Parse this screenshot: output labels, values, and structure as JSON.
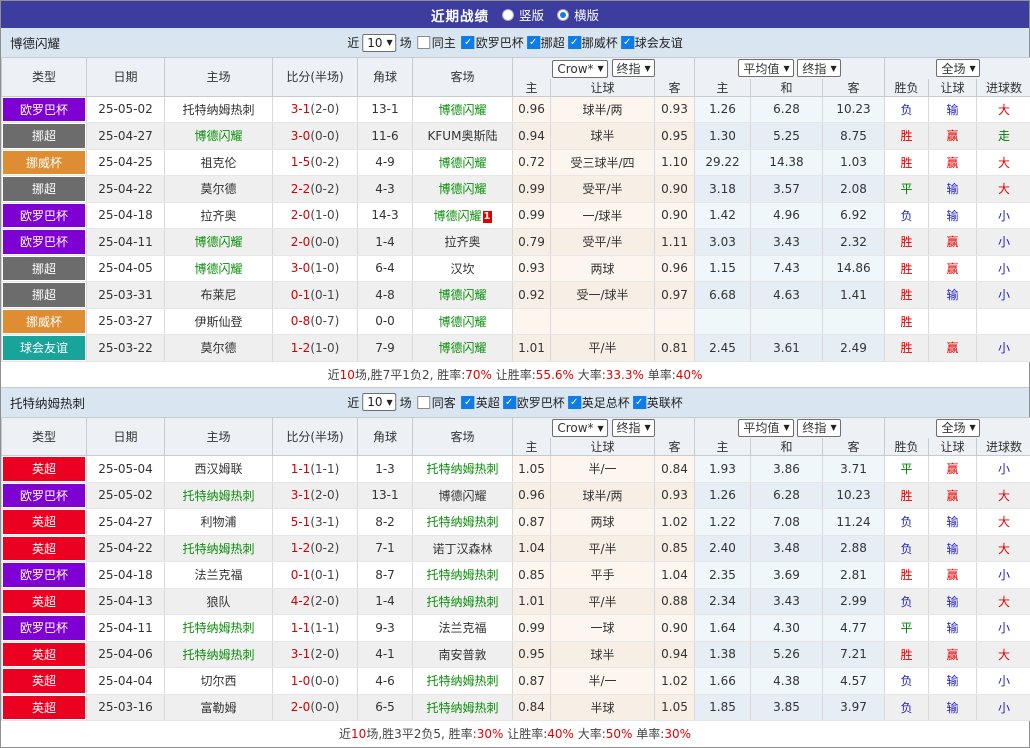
{
  "topbar": {
    "title": "近期战绩",
    "options": [
      {
        "label": "竖版",
        "selected": false
      },
      {
        "label": "横版",
        "selected": true
      }
    ]
  },
  "icons": {
    "check": "✓",
    "arrow": "▼"
  },
  "colors": {
    "topbar_bg": "#3d3da0",
    "section_bar_bg": "#d9e6f2",
    "focus_team": "#0a8f0a",
    "score": "#d40000",
    "stat_highlight": "#e60000",
    "checkbox_checked": "#0d7ce8",
    "radio_dot": "#0d7ce8"
  },
  "league_colors": {
    "欧罗巴杯": "#7f00d2",
    "挪超": "#6c6c6c",
    "挪威杯": "#de8d33",
    "球会友谊": "#18a39b",
    "英超": "#ec0022"
  },
  "result_colors": {
    "胜": "#e60000",
    "平": "#008000",
    "负": "#2222cc",
    "赢": "#e60000",
    "输": "#2222cc",
    "走": "#008000",
    "大": "#e60000",
    "小": "#2222cc"
  },
  "table": {
    "col_type": "类型",
    "col_date": "日期",
    "col_home": "主场",
    "col_score": "比分(半场)",
    "col_corner": "角球",
    "col_away": "客场",
    "sel_crow": "Crow*",
    "sel_final1": "终指",
    "sel_avg": "平均值",
    "sel_final2": "终指",
    "sel_fulltime": "全场",
    "col_h": "主",
    "col_hcap": "让球",
    "col_a": "客",
    "col_ah": "主",
    "col_ad": "和",
    "col_aa": "客",
    "col_result": "胜负",
    "col_hcap_result": "让球",
    "col_goals": "进球数"
  },
  "sections": [
    {
      "team": "博德闪耀",
      "filter": {
        "label_before": "近",
        "count": "10",
        "label_after": "场",
        "same_label": "同主",
        "same_checked": false,
        "leagues": [
          {
            "label": "欧罗巴杯",
            "checked": true
          },
          {
            "label": "挪超",
            "checked": true
          },
          {
            "label": "挪威杯",
            "checked": true
          },
          {
            "label": "球会友谊",
            "checked": true
          }
        ]
      },
      "rows": [
        {
          "league": "欧罗巴杯",
          "date": "25-05-02",
          "home": "托特纳姆热刺",
          "home_focus": false,
          "home_card": "",
          "score": "3-1",
          "half": "(2-0)",
          "corner": "13-1",
          "away": "博德闪耀",
          "away_focus": true,
          "away_card": "",
          "o1": "0.96",
          "handicap": "球半/两",
          "o2": "0.93",
          "avg_h": "1.26",
          "avg_d": "6.28",
          "avg_a": "10.23",
          "result": "负",
          "hcap_res": "输",
          "goal_res": "大"
        },
        {
          "league": "挪超",
          "date": "25-04-27",
          "home": "博德闪耀",
          "home_focus": true,
          "home_card": "",
          "score": "3-0",
          "half": "(0-0)",
          "corner": "11-6",
          "away": "KFUM奥斯陆",
          "away_focus": false,
          "away_card": "",
          "o1": "0.94",
          "handicap": "球半",
          "o2": "0.95",
          "avg_h": "1.30",
          "avg_d": "5.25",
          "avg_a": "8.75",
          "result": "胜",
          "hcap_res": "赢",
          "goal_res": "走"
        },
        {
          "league": "挪威杯",
          "date": "25-04-25",
          "home": "祖克伦",
          "home_focus": false,
          "home_card": "",
          "score": "1-5",
          "half": "(0-2)",
          "corner": "4-9",
          "away": "博德闪耀",
          "away_focus": true,
          "away_card": "",
          "o1": "0.72",
          "handicap": "受三球半/四",
          "o2": "1.10",
          "avg_h": "29.22",
          "avg_d": "14.38",
          "avg_a": "1.03",
          "result": "胜",
          "hcap_res": "赢",
          "goal_res": "大"
        },
        {
          "league": "挪超",
          "date": "25-04-22",
          "home": "莫尔德",
          "home_focus": false,
          "home_card": "",
          "score": "2-2",
          "half": "(0-2)",
          "corner": "4-3",
          "away": "博德闪耀",
          "away_focus": true,
          "away_card": "",
          "o1": "0.99",
          "handicap": "受平/半",
          "o2": "0.90",
          "avg_h": "3.18",
          "avg_d": "3.57",
          "avg_a": "2.08",
          "result": "平",
          "hcap_res": "输",
          "goal_res": "大"
        },
        {
          "league": "欧罗巴杯",
          "date": "25-04-18",
          "home": "拉齐奥",
          "home_focus": false,
          "home_card": "",
          "score": "2-0",
          "half": "(1-0)",
          "corner": "14-3",
          "away": "博德闪耀",
          "away_focus": true,
          "away_card": "1",
          "o1": "0.99",
          "handicap": "一/球半",
          "o2": "0.90",
          "avg_h": "1.42",
          "avg_d": "4.96",
          "avg_a": "6.92",
          "result": "负",
          "hcap_res": "输",
          "goal_res": "小"
        },
        {
          "league": "欧罗巴杯",
          "date": "25-04-11",
          "home": "博德闪耀",
          "home_focus": true,
          "home_card": "",
          "score": "2-0",
          "half": "(0-0)",
          "corner": "1-4",
          "away": "拉齐奥",
          "away_focus": false,
          "away_card": "",
          "o1": "0.79",
          "handicap": "受平/半",
          "o2": "1.11",
          "avg_h": "3.03",
          "avg_d": "3.43",
          "avg_a": "2.32",
          "result": "胜",
          "hcap_res": "赢",
          "goal_res": "小"
        },
        {
          "league": "挪超",
          "date": "25-04-05",
          "home": "博德闪耀",
          "home_focus": true,
          "home_card": "",
          "score": "3-0",
          "half": "(1-0)",
          "corner": "6-4",
          "away": "汉坎",
          "away_focus": false,
          "away_card": "",
          "o1": "0.93",
          "handicap": "两球",
          "o2": "0.96",
          "avg_h": "1.15",
          "avg_d": "7.43",
          "avg_a": "14.86",
          "result": "胜",
          "hcap_res": "赢",
          "goal_res": "小"
        },
        {
          "league": "挪超",
          "date": "25-03-31",
          "home": "布莱尼",
          "home_focus": false,
          "home_card": "",
          "score": "0-1",
          "half": "(0-1)",
          "corner": "4-8",
          "away": "博德闪耀",
          "away_focus": true,
          "away_card": "",
          "o1": "0.92",
          "handicap": "受一/球半",
          "o2": "0.97",
          "avg_h": "6.68",
          "avg_d": "4.63",
          "avg_a": "1.41",
          "result": "胜",
          "hcap_res": "输",
          "goal_res": "小"
        },
        {
          "league": "挪威杯",
          "date": "25-03-27",
          "home": "伊斯仙登",
          "home_focus": false,
          "home_card": "",
          "score": "0-8",
          "half": "(0-7)",
          "corner": "0-0",
          "away": "博德闪耀",
          "away_focus": true,
          "away_card": "",
          "o1": "",
          "handicap": "",
          "o2": "",
          "avg_h": "",
          "avg_d": "",
          "avg_a": "",
          "result": "胜",
          "hcap_res": "",
          "goal_res": ""
        },
        {
          "league": "球会友谊",
          "date": "25-03-22",
          "home": "莫尔德",
          "home_focus": false,
          "home_card": "",
          "score": "1-2",
          "half": "(1-0)",
          "corner": "7-9",
          "away": "博德闪耀",
          "away_focus": true,
          "away_card": "",
          "o1": "1.01",
          "handicap": "平/半",
          "o2": "0.81",
          "avg_h": "2.45",
          "avg_d": "3.61",
          "avg_a": "2.49",
          "result": "胜",
          "hcap_res": "赢",
          "goal_res": "小"
        }
      ],
      "summary": [
        {
          "t": "近",
          "red": false
        },
        {
          "t": "10",
          "red": true
        },
        {
          "t": "场,胜7平1负2, 胜率:",
          "red": false
        },
        {
          "t": "70%",
          "red": true
        },
        {
          "t": " 让胜率:",
          "red": false
        },
        {
          "t": "55.6%",
          "red": true
        },
        {
          "t": " 大率:",
          "red": false
        },
        {
          "t": "33.3%",
          "red": true
        },
        {
          "t": " 单率:",
          "red": false
        },
        {
          "t": "40%",
          "red": true
        }
      ]
    },
    {
      "team": "托特纳姆热刺",
      "filter": {
        "label_before": "近",
        "count": "10",
        "label_after": "场",
        "same_label": "同客",
        "same_checked": false,
        "leagues": [
          {
            "label": "英超",
            "checked": true
          },
          {
            "label": "欧罗巴杯",
            "checked": true
          },
          {
            "label": "英足总杯",
            "checked": true
          },
          {
            "label": "英联杯",
            "checked": true
          }
        ]
      },
      "rows": [
        {
          "league": "英超",
          "date": "25-05-04",
          "home": "西汉姆联",
          "home_focus": false,
          "home_card": "",
          "score": "1-1",
          "half": "(1-1)",
          "corner": "1-3",
          "away": "托特纳姆热刺",
          "away_focus": true,
          "away_card": "",
          "o1": "1.05",
          "handicap": "半/一",
          "o2": "0.84",
          "avg_h": "1.93",
          "avg_d": "3.86",
          "avg_a": "3.71",
          "result": "平",
          "hcap_res": "赢",
          "goal_res": "小"
        },
        {
          "league": "欧罗巴杯",
          "date": "25-05-02",
          "home": "托特纳姆热刺",
          "home_focus": true,
          "home_card": "",
          "score": "3-1",
          "half": "(2-0)",
          "corner": "13-1",
          "away": "博德闪耀",
          "away_focus": false,
          "away_card": "",
          "o1": "0.96",
          "handicap": "球半/两",
          "o2": "0.93",
          "avg_h": "1.26",
          "avg_d": "6.28",
          "avg_a": "10.23",
          "result": "胜",
          "hcap_res": "赢",
          "goal_res": "大"
        },
        {
          "league": "英超",
          "date": "25-04-27",
          "home": "利物浦",
          "home_focus": false,
          "home_card": "",
          "score": "5-1",
          "half": "(3-1)",
          "corner": "8-2",
          "away": "托特纳姆热刺",
          "away_focus": true,
          "away_card": "",
          "o1": "0.87",
          "handicap": "两球",
          "o2": "1.02",
          "avg_h": "1.22",
          "avg_d": "7.08",
          "avg_a": "11.24",
          "result": "负",
          "hcap_res": "输",
          "goal_res": "大"
        },
        {
          "league": "英超",
          "date": "25-04-22",
          "home": "托特纳姆热刺",
          "home_focus": true,
          "home_card": "",
          "score": "1-2",
          "half": "(0-2)",
          "corner": "7-1",
          "away": "诺丁汉森林",
          "away_focus": false,
          "away_card": "",
          "o1": "1.04",
          "handicap": "平/半",
          "o2": "0.85",
          "avg_h": "2.40",
          "avg_d": "3.48",
          "avg_a": "2.88",
          "result": "负",
          "hcap_res": "输",
          "goal_res": "大"
        },
        {
          "league": "欧罗巴杯",
          "date": "25-04-18",
          "home": "法兰克福",
          "home_focus": false,
          "home_card": "",
          "score": "0-1",
          "half": "(0-1)",
          "corner": "8-7",
          "away": "托特纳姆热刺",
          "away_focus": true,
          "away_card": "",
          "o1": "0.85",
          "handicap": "平手",
          "o2": "1.04",
          "avg_h": "2.35",
          "avg_d": "3.69",
          "avg_a": "2.81",
          "result": "胜",
          "hcap_res": "赢",
          "goal_res": "小"
        },
        {
          "league": "英超",
          "date": "25-04-13",
          "home": "狼队",
          "home_focus": false,
          "home_card": "",
          "score": "4-2",
          "half": "(2-0)",
          "corner": "1-4",
          "away": "托特纳姆热刺",
          "away_focus": true,
          "away_card": "",
          "o1": "1.01",
          "handicap": "平/半",
          "o2": "0.88",
          "avg_h": "2.34",
          "avg_d": "3.43",
          "avg_a": "2.99",
          "result": "负",
          "hcap_res": "输",
          "goal_res": "大"
        },
        {
          "league": "欧罗巴杯",
          "date": "25-04-11",
          "home": "托特纳姆热刺",
          "home_focus": true,
          "home_card": "",
          "score": "1-1",
          "half": "(1-1)",
          "corner": "9-3",
          "away": "法兰克福",
          "away_focus": false,
          "away_card": "",
          "o1": "0.99",
          "handicap": "一球",
          "o2": "0.90",
          "avg_h": "1.64",
          "avg_d": "4.30",
          "avg_a": "4.77",
          "result": "平",
          "hcap_res": "输",
          "goal_res": "小"
        },
        {
          "league": "英超",
          "date": "25-04-06",
          "home": "托特纳姆热刺",
          "home_focus": true,
          "home_card": "",
          "score": "3-1",
          "half": "(2-0)",
          "corner": "4-1",
          "away": "南安普敦",
          "away_focus": false,
          "away_card": "",
          "o1": "0.95",
          "handicap": "球半",
          "o2": "0.94",
          "avg_h": "1.38",
          "avg_d": "5.26",
          "avg_a": "7.21",
          "result": "胜",
          "hcap_res": "赢",
          "goal_res": "大"
        },
        {
          "league": "英超",
          "date": "25-04-04",
          "home": "切尔西",
          "home_focus": false,
          "home_card": "",
          "score": "1-0",
          "half": "(0-0)",
          "corner": "4-6",
          "away": "托特纳姆热刺",
          "away_focus": true,
          "away_card": "",
          "o1": "0.87",
          "handicap": "半/一",
          "o2": "1.02",
          "avg_h": "1.66",
          "avg_d": "4.38",
          "avg_a": "4.57",
          "result": "负",
          "hcap_res": "输",
          "goal_res": "小"
        },
        {
          "league": "英超",
          "date": "25-03-16",
          "home": "富勒姆",
          "home_focus": false,
          "home_card": "",
          "score": "2-0",
          "half": "(0-0)",
          "corner": "6-5",
          "away": "托特纳姆热刺",
          "away_focus": true,
          "away_card": "",
          "o1": "0.84",
          "handicap": "半球",
          "o2": "1.05",
          "avg_h": "1.85",
          "avg_d": "3.85",
          "avg_a": "3.97",
          "result": "负",
          "hcap_res": "输",
          "goal_res": "小"
        }
      ],
      "summary": [
        {
          "t": "近",
          "red": false
        },
        {
          "t": "10",
          "red": true
        },
        {
          "t": "场,胜3平2负5, 胜率:",
          "red": false
        },
        {
          "t": "30%",
          "red": true
        },
        {
          "t": " 让胜率:",
          "red": false
        },
        {
          "t": "40%",
          "red": true
        },
        {
          "t": " 大率:",
          "red": false
        },
        {
          "t": "50%",
          "red": true
        },
        {
          "t": " 单率:",
          "red": false
        },
        {
          "t": "30%",
          "red": true
        }
      ]
    }
  ]
}
